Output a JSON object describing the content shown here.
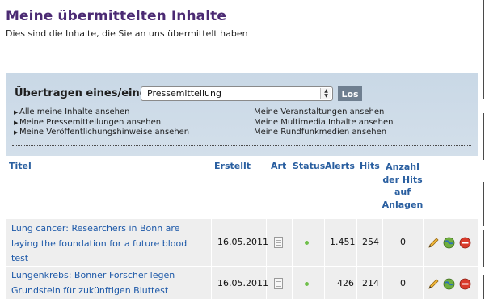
{
  "header": {
    "title": "Meine übermittelten Inhalte",
    "subtitle": "Dies sind die Inhalte, die Sie an uns übermittelt haben"
  },
  "panel": {
    "label": "Übertragen eines/einer",
    "select_value": "Pressemitteilung",
    "button_label": "Los",
    "links_left": [
      "Alle meine Inhalte ansehen",
      "Meine Pressemitteilungen ansehen",
      "Meine Veröffentlichungshinweise ansehen"
    ],
    "links_right": [
      "Meine Veranstaltungen ansehen",
      "Meine Multimedia Inhalte ansehen",
      "Meine Rundfunkmedien ansehen"
    ]
  },
  "table": {
    "columns": {
      "titel": "Titel",
      "erstellt": "Erstellt",
      "art": "Art",
      "status": "Status",
      "alerts": "Alerts",
      "hits": "Hits",
      "anzahl_lines": [
        "Anzahl",
        "der Hits",
        "auf",
        "Anlagen"
      ]
    },
    "rows": [
      {
        "title_lines": [
          "Lung cancer: Researchers in Bonn are",
          "laying the foundation for a future blood",
          "test"
        ],
        "date": "16.05.2011",
        "alerts": "1.451",
        "hits": "254",
        "anlagen_hits": "0"
      },
      {
        "title_lines": [
          "Lungenkrebs: Bonner Forscher legen",
          "Grundstein für zukünftigen Bluttest"
        ],
        "date": "16.05.2011",
        "alerts": "426",
        "hits": "214",
        "anlagen_hits": "0"
      }
    ]
  },
  "icons": {
    "document": "document-icon",
    "status": "status-dot-icon",
    "edit": "pencil-icon",
    "view": "globe-icon",
    "delete": "delete-icon"
  },
  "colors": {
    "title": "#4b2a73",
    "link": "#1c58a8",
    "header_text": "#2a5fa0",
    "panel_bg": "#cfdbe8",
    "button_bg": "#6f7f90",
    "row_bg": "#eeeeee",
    "status_ok": "#6fbf4a",
    "delete": "#d93a2b"
  }
}
